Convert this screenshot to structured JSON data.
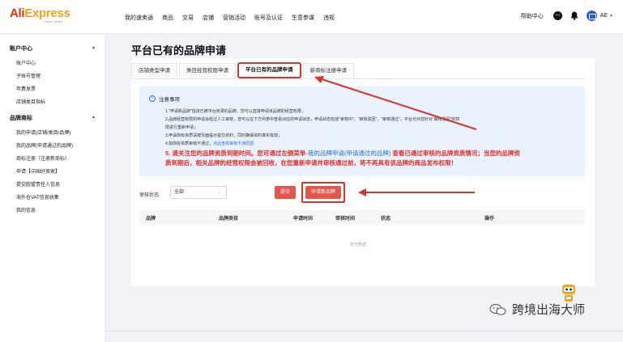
{
  "logo": {
    "main_a": "Ali",
    "main_x": "Express",
    "sub": "Seller Center"
  },
  "nav": [
    "我的速卖通",
    "商品",
    "交易",
    "店铺",
    "营销活动",
    "账号及认证",
    "生意参谋",
    "违规"
  ],
  "top_right": {
    "help": "帮助中心",
    "account": "AE"
  },
  "sidebar": {
    "section1": {
      "title": "账户中心",
      "items": [
        "账户中心",
        "子账号管理",
        "年费发票",
        "店铺类目指标"
      ]
    },
    "section2": {
      "title": "品牌商标",
      "items": [
        "我的申请(店铺/类目/品牌)",
        "我的品牌(申请通过的品牌)",
        "商标注册（注册新商标）",
        "申请【中国好卖家】",
        "提交欧盟责任人信息",
        "海外仓VAT信息收集",
        "我的信息"
      ]
    }
  },
  "page_title": "平台已有的品牌申请",
  "tabs": [
    "店铺类型申请",
    "类目经营权限申请",
    "平台已有的品牌申请",
    "新商标注册申请"
  ],
  "notice": {
    "title": "注意事项",
    "line1": "1.\"申请新品牌\"指该已被平台收录的品牌，您可以直接申请该品牌的经营权限；",
    "line2": "2.品牌经营权限的申请会经过人工审核，您可以在下方列表中查看对应的申请状态，申请状态包括\"审核中\"、\"审核驳回\"、\"审核通过\"，平台允许您针对\"审核驳回\"的权",
    "line3": "限进行重新申请；",
    "line4": "3.申请商标资质请按页面提示提交资料，同时确保资料真实有效；",
    "line5a": "4.如商标资质审核不通过，",
    "line5b": "点此查看审核不通原因",
    "red1a": "5. 请关注您的品牌资质到期时间。您可通过左侧菜单-",
    "red1b": "我的品牌申请(申请通过的品牌)",
    "red1c": " 查看已通过审核的品牌资质情况；当您的品牌资",
    "red2": "质到期后，相关品牌的经营权限会被回收，在您重新申请并审核通过前，将不再具有该品牌的商品发布权限！"
  },
  "filter": {
    "label": "审核状态",
    "value": "全部"
  },
  "buttons": {
    "submit": "提交",
    "apply": "申请新品牌"
  },
  "table": {
    "headers": [
      "品牌",
      "品牌类目",
      "申请时间",
      "审核时间",
      "状态",
      "操作"
    ],
    "empty": "暂无数据"
  },
  "watermark": "跨境出海大师",
  "colors": {
    "brand_red": "#e62e04",
    "accent_red": "#d9342b",
    "link_blue": "#2a6de0",
    "notice_bg": "#e9f2fd"
  }
}
